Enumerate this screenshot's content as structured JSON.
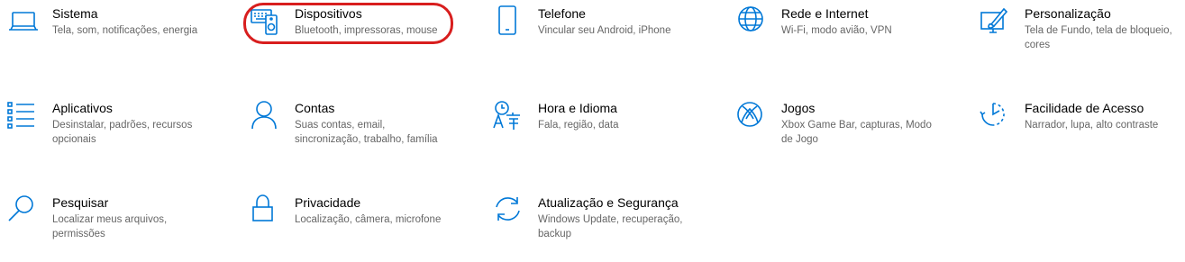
{
  "tiles": [
    {
      "id": "sistema",
      "title": "Sistema",
      "desc": "Tela, som, notificações, energia"
    },
    {
      "id": "dispositivos",
      "title": "Dispositivos",
      "desc": "Bluetooth, impressoras, mouse"
    },
    {
      "id": "telefone",
      "title": "Telefone",
      "desc": "Vincular seu Android, iPhone"
    },
    {
      "id": "rede",
      "title": "Rede e Internet",
      "desc": "Wi-Fi, modo avião, VPN"
    },
    {
      "id": "personalizacao",
      "title": "Personalização",
      "desc": "Tela de Fundo, tela de bloqueio, cores"
    },
    {
      "id": "aplicativos",
      "title": "Aplicativos",
      "desc": "Desinstalar, padrões, recursos opcionais"
    },
    {
      "id": "contas",
      "title": "Contas",
      "desc": "Suas contas, email, sincronização, trabalho, família"
    },
    {
      "id": "hora",
      "title": "Hora e Idioma",
      "desc": "Fala, região, data"
    },
    {
      "id": "jogos",
      "title": "Jogos",
      "desc": "Xbox Game Bar, capturas, Modo de Jogo"
    },
    {
      "id": "facilidade",
      "title": "Facilidade de Acesso",
      "desc": "Narrador, lupa, alto contraste"
    },
    {
      "id": "pesquisar",
      "title": "Pesquisar",
      "desc": "Localizar meus arquivos, permissões"
    },
    {
      "id": "privacidade",
      "title": "Privacidade",
      "desc": "Localização, câmera, microfone"
    },
    {
      "id": "atualizacao",
      "title": "Atualização e Segurança",
      "desc": "Windows Update, recuperação, backup"
    }
  ],
  "icons": {
    "sistema": "laptop-icon",
    "dispositivos": "devices-icon",
    "telefone": "phone-icon",
    "rede": "globe-icon",
    "personalizacao": "paint-brush-icon",
    "aplicativos": "apps-list-icon",
    "contas": "person-icon",
    "hora": "time-language-icon",
    "jogos": "xbox-icon",
    "facilidade": "ease-of-access-icon",
    "pesquisar": "search-icon",
    "privacidade": "lock-icon",
    "atualizacao": "sync-icon"
  },
  "accent_color": "#0078d7",
  "highlight_color": "#d81e1e"
}
